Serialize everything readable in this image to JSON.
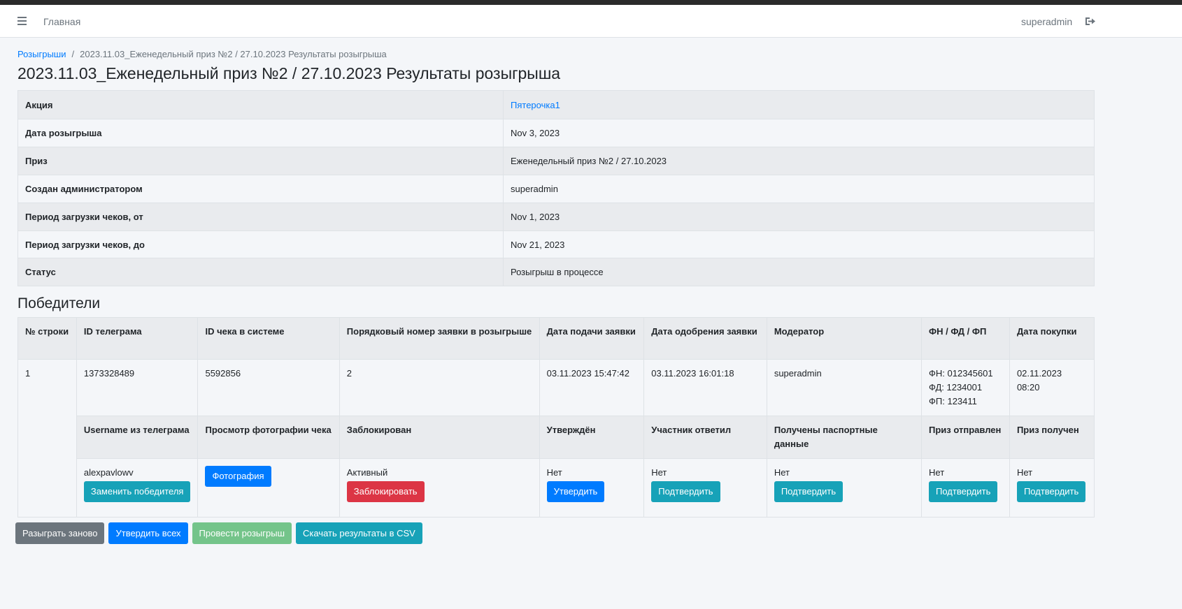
{
  "navbar": {
    "home_label": "Главная",
    "user_label": "superadmin",
    "menu_icon": "hamburger-icon",
    "logout_icon": "logout-icon"
  },
  "breadcrumb": {
    "root_label": "Розыгрыши",
    "separator": "/",
    "current_label": "2023.11.03_Еженедельный приз №2 / 27.10.2023 Результаты розыгрыша"
  },
  "page_title": "2023.11.03_Еженедельный приз №2 / 27.10.2023 Результаты розыгрыша",
  "info": {
    "rows": [
      {
        "key": "Акция",
        "value": "Пятерочка1"
      },
      {
        "key": "Дата розыгрыша",
        "value": "Nov 3, 2023"
      },
      {
        "key": "Приз",
        "value": "Еженедельный приз №2 / 27.10.2023"
      },
      {
        "key": "Создан администратором",
        "value": "superadmin"
      },
      {
        "key": "Период загрузки чеков, от",
        "value": "Nov 1, 2023"
      },
      {
        "key": "Период загрузки чеков, до",
        "value": "Nov 21, 2023"
      },
      {
        "key": "Статус",
        "value": "Розыгрыш в процессе"
      }
    ]
  },
  "winners": {
    "title": "Победители",
    "headers": [
      "№ строки",
      "ID телеграма",
      "ID чека в системе",
      "Порядковый номер заявки в розыгрыше",
      "Дата подачи заявки",
      "Дата одобрения заявки",
      "Модератор",
      "ФН / ФД / ФП",
      "Дата покупки"
    ],
    "row": {
      "num": "1",
      "telegram_id": "1373328489",
      "check_id": "5592856",
      "order_num": "2",
      "submit_date": "03.11.2023 15:47:42",
      "approve_date": "03.11.2023 16:01:18",
      "moderator": "superadmin",
      "fn": "ФН: 012345601",
      "fd": "ФД: 1234001",
      "fp": "ФП: 123411",
      "purchase_date": "02.11.2023 08:20"
    },
    "sub_headers": [
      "Username из телеграма",
      "Просмотр фотографии чека",
      "Заблокирован",
      "Утверждён",
      "Участник ответил",
      "Получены паспортные данные",
      "Приз отправлен",
      "Приз получен"
    ],
    "sub_row": {
      "username": "alexpavlowv",
      "replace_btn": "Заменить победителя",
      "photo_btn": "Фотография",
      "blocked_status": "Активный",
      "block_btn": "Заблокировать",
      "approved_value": "Нет",
      "approve_btn": "Утвердить",
      "replied_value": "Нет",
      "replied_btn": "Подтвердить",
      "passport_value": "Нет",
      "passport_btn": "Подтвердить",
      "sent_value": "Нет",
      "sent_btn": "Подтвердить",
      "received_value": "Нет",
      "received_btn": "Подтвердить"
    }
  },
  "actions": {
    "redraw": "Разыграть заново",
    "approve_all": "Утвердить всех",
    "run_draw": "Провести розыгрыш",
    "download_csv": "Скачать результаты в CSV"
  },
  "colors": {
    "primary": "#007bff",
    "info": "#17a2b8",
    "danger": "#dc3545",
    "secondary": "#6c757d",
    "success_disabled": "#74c48a"
  }
}
